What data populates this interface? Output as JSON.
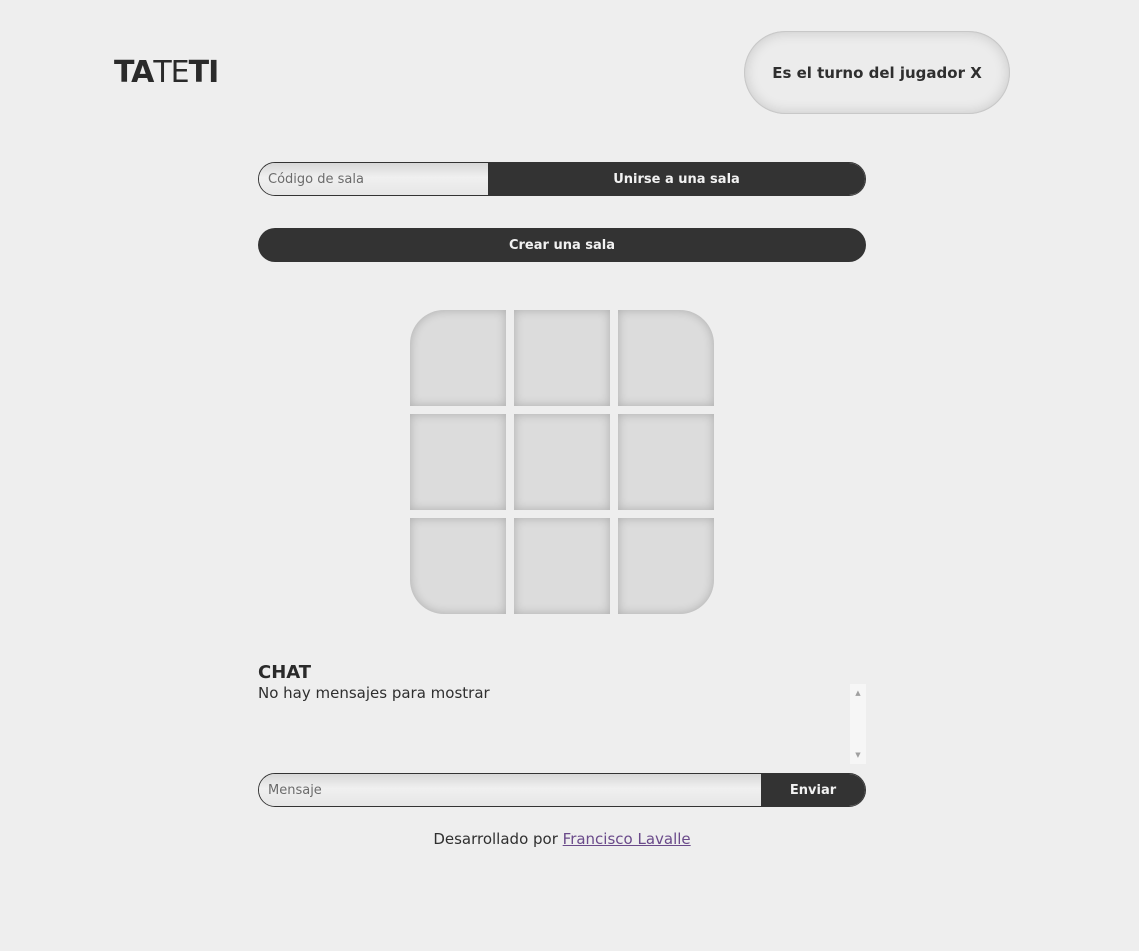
{
  "header": {
    "logo_parts": [
      "TA",
      "TE",
      "TI"
    ],
    "turn_text": "Es el turno del jugador X"
  },
  "join": {
    "placeholder": "Código de sala",
    "button_label": "Unirse a una sala"
  },
  "create": {
    "button_label": "Crear una sala"
  },
  "board": {
    "cells": [
      "",
      "",
      "",
      "",
      "",
      "",
      "",
      "",
      ""
    ]
  },
  "chat": {
    "title": "CHAT",
    "empty_text": "No hay mensajes para mostrar",
    "input_placeholder": "Mensaje",
    "send_label": "Enviar"
  },
  "footer": {
    "prefix": "Desarrollado por ",
    "author_link": "Francisco Lavalle"
  }
}
